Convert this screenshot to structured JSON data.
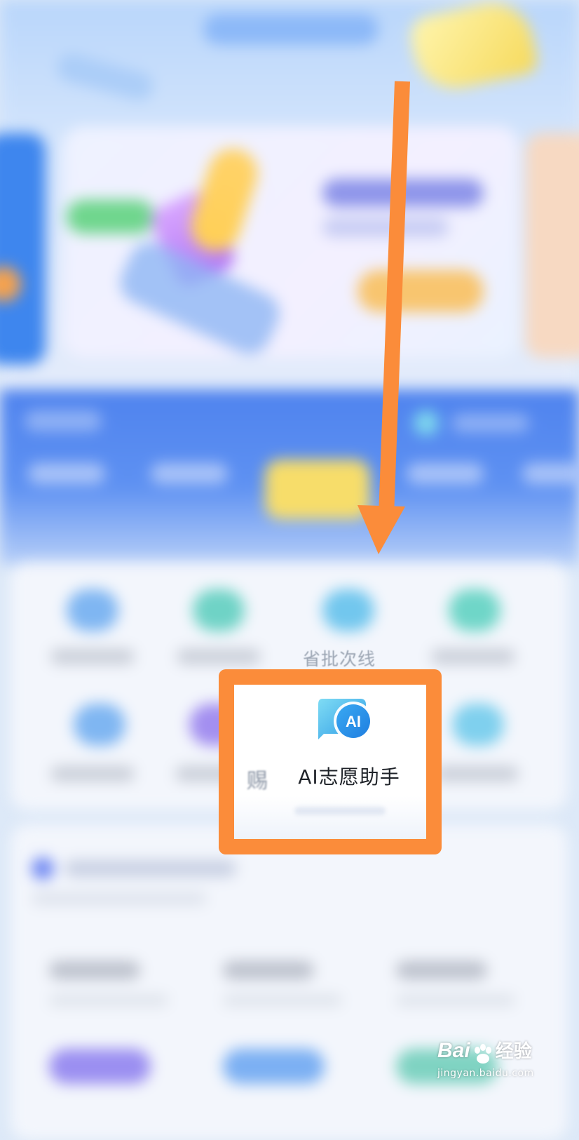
{
  "feature_grid": {
    "partial_label_above": "省批次线",
    "partial_left_char": "赐",
    "highlighted_item": {
      "icon": "ai-chat-bubble-icon",
      "icon_text": "AI",
      "label": "AI志愿助手"
    }
  },
  "annotation": {
    "arrow_color": "#fb8c3a",
    "frame_color": "#fb8c3a"
  },
  "watermark": {
    "brand_prefix": "Bai",
    "brand_suffix": "经验",
    "url": "jingyan.baidu.com"
  },
  "colors": {
    "header_blue": "#4f83ee",
    "active_tab_yellow": "#f7dd6a"
  }
}
